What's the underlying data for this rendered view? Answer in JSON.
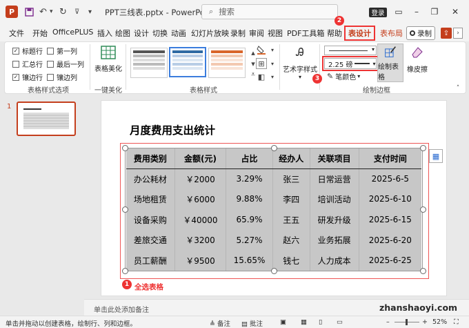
{
  "titlebar": {
    "file_title": "PPT三线表.pptx - PowerPo...",
    "search_placeholder": "搜索",
    "login_label": "登录",
    "icons": [
      "ppt-logo-icon",
      "save-icon",
      "undo-icon",
      "redo-icon",
      "customize-icon",
      "search-icon",
      "minimize-icon",
      "restore-icon",
      "close-icon"
    ]
  },
  "tabs": [
    "文件",
    "开始",
    "OfficePLUS",
    "插入",
    "绘图",
    "设计",
    "切换",
    "动画",
    "幻灯片放映",
    "录制",
    "审阅",
    "视图",
    "PDF工具箱",
    "帮助",
    "表设计",
    "表布局"
  ],
  "record_label": "录制",
  "markers": {
    "m1": "1",
    "m2": "2",
    "m3": "3"
  },
  "ribbon": {
    "options": {
      "header_row": "标题行",
      "first_column": "第一列",
      "total_row": "汇总行",
      "last_column": "最后一列",
      "banded_rows": "镶边行",
      "banded_columns": "镶边列",
      "group_label": "表格样式选项",
      "checked": {
        "header_row": true,
        "first_column": false,
        "total_row": false,
        "last_column": false,
        "banded_rows": true,
        "banded_columns": false
      }
    },
    "beautify": {
      "button_label": "表格美化",
      "group_label": "一键美化"
    },
    "styles": {
      "group_label": "表格样式"
    },
    "art": {
      "button_label": "艺术字样式"
    },
    "borders": {
      "pen_weight": "2.25 磅",
      "pen_color": "笔颜色",
      "draw_table": "绘制表格",
      "eraser": "橡皮擦",
      "group_label": "绘制边框"
    }
  },
  "slide": {
    "number": "1",
    "title": "月度费用支出统计",
    "table": {
      "headers": [
        "费用类别",
        "金额(元)",
        "占比",
        "经办人",
        "关联项目",
        "支付时间"
      ],
      "rows": [
        [
          "办公耗材",
          "￥2000",
          "3.29%",
          "张三",
          "日常运营",
          "2025-6-5"
        ],
        [
          "场地租赁",
          "￥6000",
          "9.88%",
          "李四",
          "培训活动",
          "2025-6-10"
        ],
        [
          "设备采购",
          "￥40000",
          "65.9%",
          "王五",
          "研发升级",
          "2025-6-15"
        ],
        [
          "差旅交通",
          "￥3200",
          "5.27%",
          "赵六",
          "业务拓展",
          "2025-6-20"
        ],
        [
          "员工薪酬",
          "￥9500",
          "15.65%",
          "钱七",
          "人力成本",
          "2025-6-25"
        ]
      ]
    },
    "select_note": "全选表格"
  },
  "notes_placeholder": "单击此处添加备注",
  "status": {
    "hint": "单击并拖动以创建表格，绘制行、列和边框。",
    "notes_label": "备注",
    "comments_label": "批注",
    "zoom": "52%"
  },
  "watermark": "zhanshaoyi.com",
  "colors": {
    "accent": "#c43e1c",
    "highlight": "#e33333",
    "table_fill": "#c7c7c7"
  }
}
